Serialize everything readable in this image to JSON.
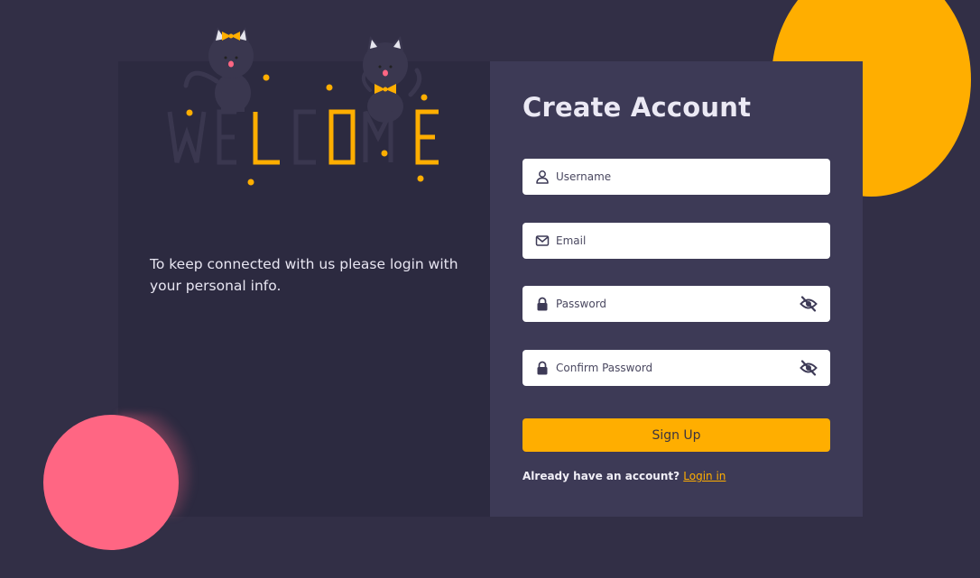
{
  "welcome_panel": {
    "tagline": "To keep connected with us please login with your personal info.",
    "art_word": "WELCOME"
  },
  "form": {
    "title": "Create Account",
    "fields": [
      {
        "placeholder": "Username",
        "icon": "user-icon"
      },
      {
        "placeholder": "Email",
        "icon": "envelope-icon"
      },
      {
        "placeholder": "Password",
        "icon": "lock-icon",
        "toggle_icon": "eye-slash-icon"
      },
      {
        "placeholder": "Confirm Password",
        "icon": "lock-icon",
        "toggle_icon": "eye-slash-icon"
      }
    ],
    "submit_label": "Sign Up",
    "footer_text": "Already have an account?",
    "footer_link": "Login in"
  },
  "colors": {
    "background": "#322f46",
    "left_panel": "#2c2a40",
    "right_panel": "#3d3a56",
    "accent": "#ffae00",
    "pink": "#ff6683"
  }
}
